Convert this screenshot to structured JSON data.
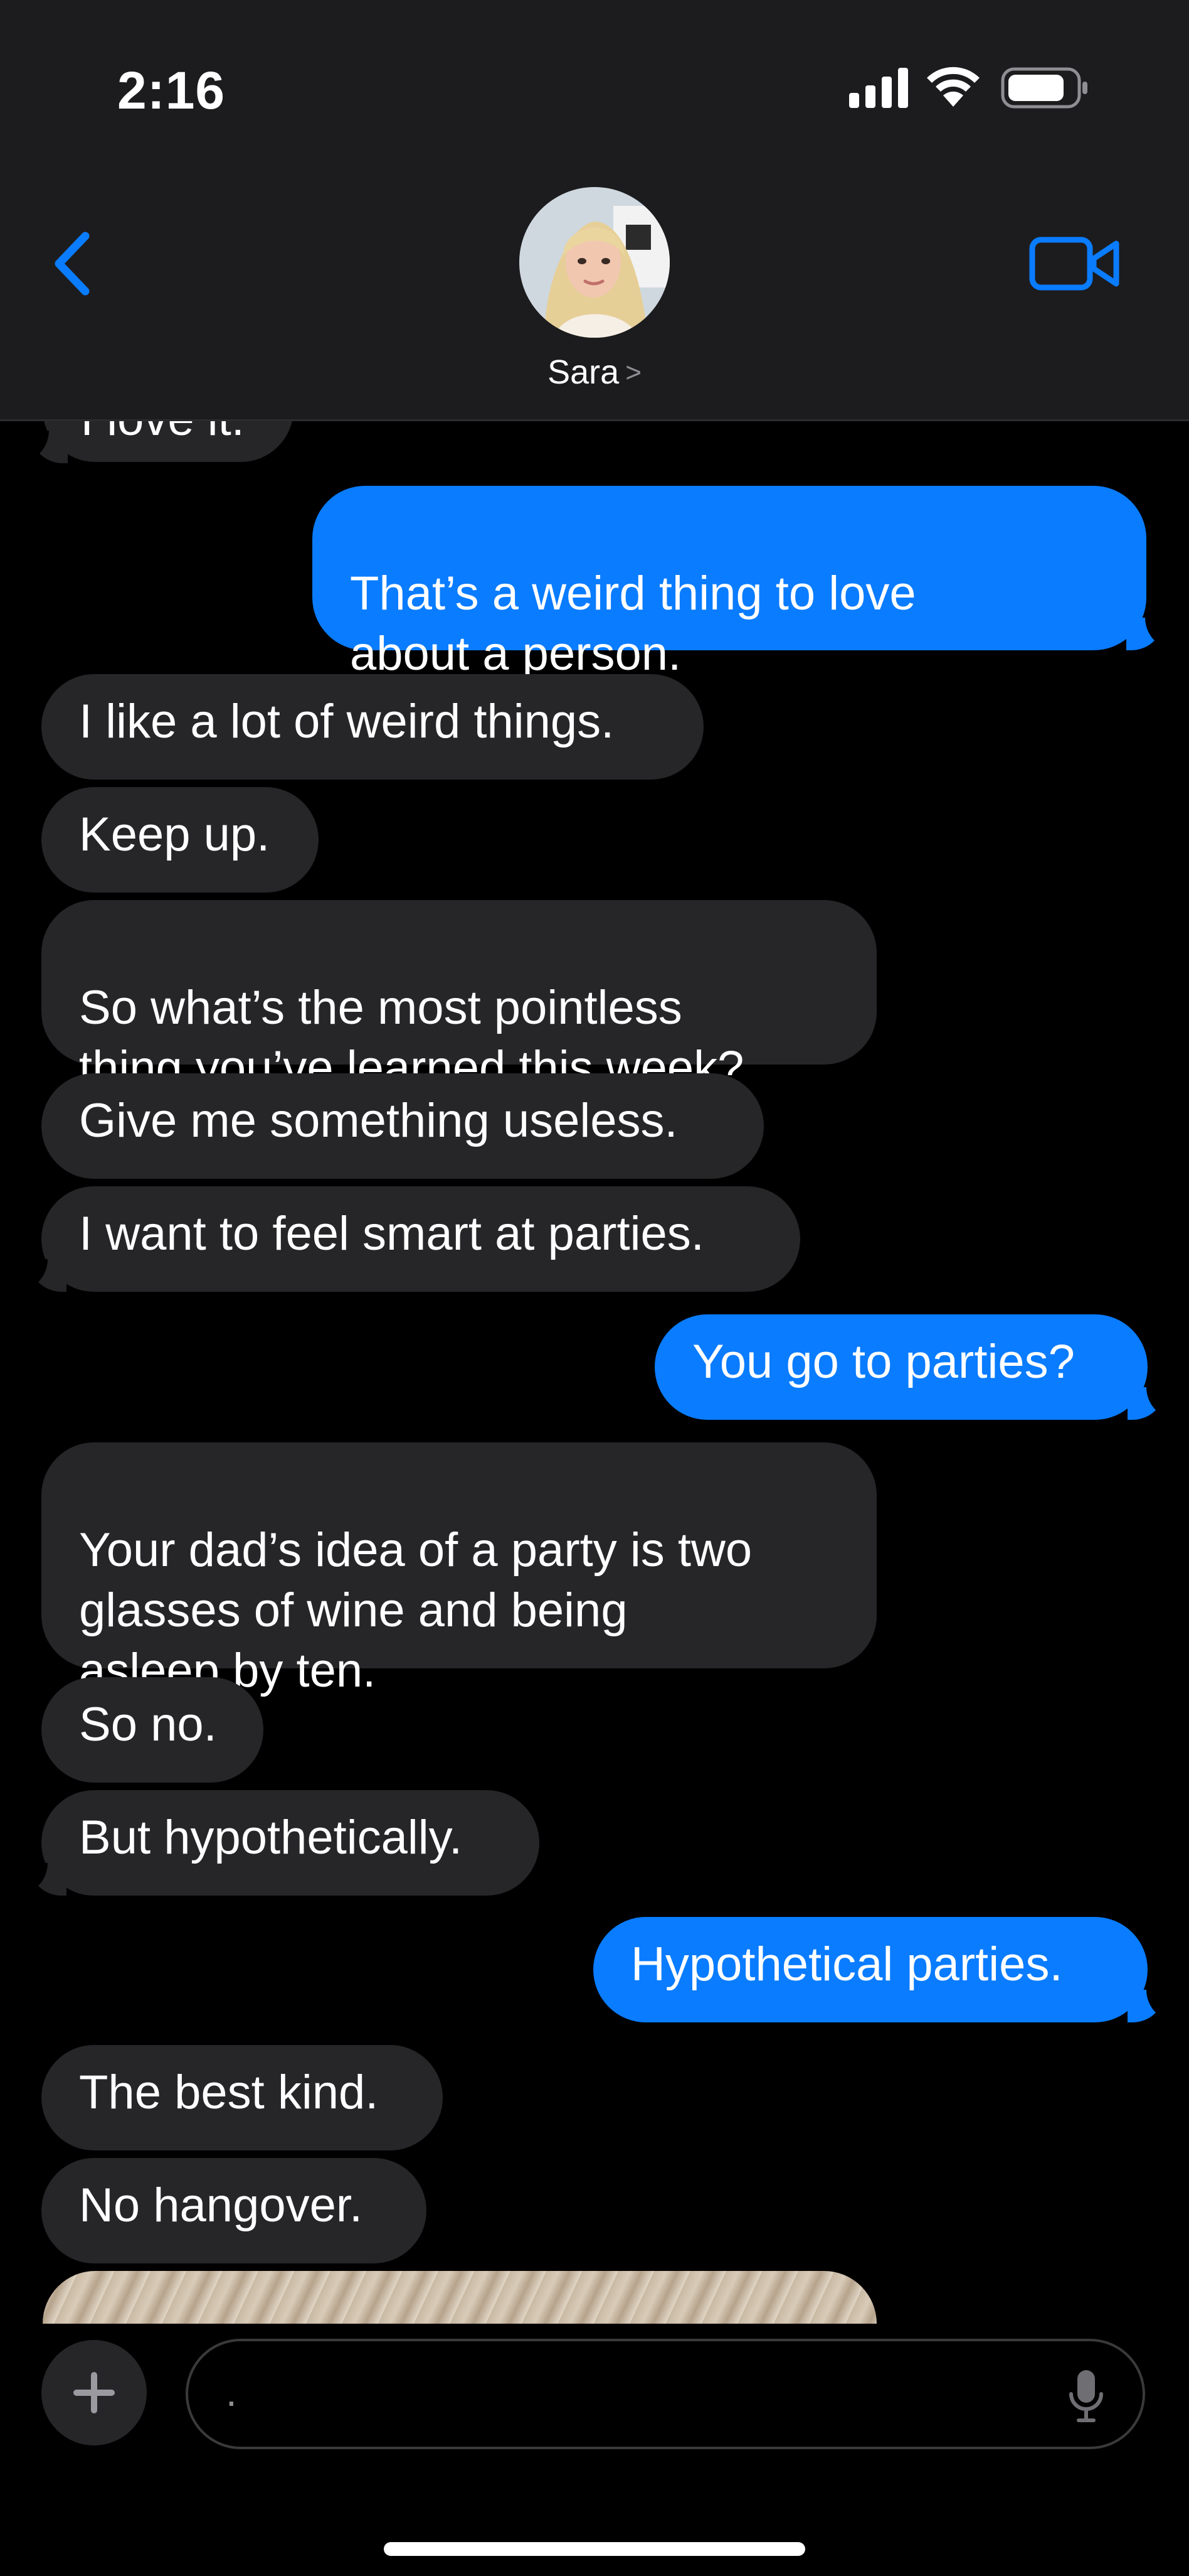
{
  "status_bar": {
    "time": "2:16",
    "icons": [
      "cellular-signal-icon",
      "wifi-icon",
      "battery-icon"
    ]
  },
  "header": {
    "contact_name": "Sara",
    "chevron": ">",
    "back_icon": "chevron-left-icon",
    "video_icon": "video-camera-icon",
    "accent_color": "#0a7cff",
    "background_color": "#1c1c1e"
  },
  "messages": [
    {
      "sender": "them",
      "text": "I love it."
    },
    {
      "sender": "me",
      "text": "That’s a weird thing to love\nabout a person."
    },
    {
      "sender": "them",
      "text": "I like a lot of weird things."
    },
    {
      "sender": "them",
      "text": "Keep up."
    },
    {
      "sender": "them",
      "text": "So what’s the most pointless\nthing you’ve learned this week?"
    },
    {
      "sender": "them",
      "text": "Give me something useless."
    },
    {
      "sender": "them",
      "text": "I want to feel smart at parties."
    },
    {
      "sender": "me",
      "text": "You go to parties?"
    },
    {
      "sender": "them",
      "text": "Your dad’s idea of a party is two\nglasses of wine and being\nasleep by ten."
    },
    {
      "sender": "them",
      "text": "So no."
    },
    {
      "sender": "them",
      "text": "But hypothetically."
    },
    {
      "sender": "me",
      "text": "Hypothetical parties."
    },
    {
      "sender": "them",
      "text": "The best kind."
    },
    {
      "sender": "them",
      "text": "No hangover."
    }
  ],
  "bubble_colors": {
    "incoming": "#262629",
    "outgoing": "#0a7cff"
  },
  "composer": {
    "placeholder": ".",
    "add_icon": "plus-icon",
    "mic_icon": "microphone-icon"
  }
}
